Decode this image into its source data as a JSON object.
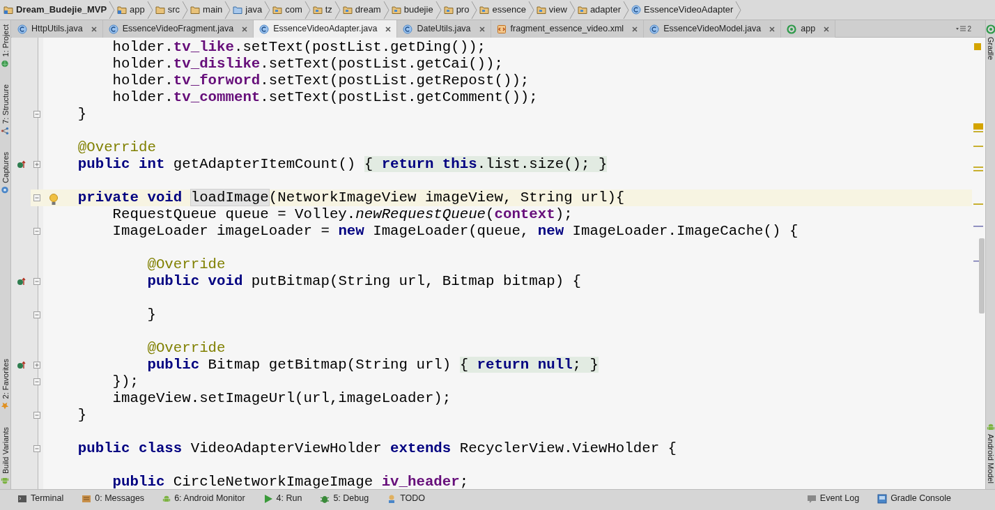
{
  "breadcrumbs": [
    {
      "label": "Dream_Budejie_MVP",
      "kind": "module"
    },
    {
      "label": "app",
      "kind": "module"
    },
    {
      "label": "src",
      "kind": "folder"
    },
    {
      "label": "main",
      "kind": "folder"
    },
    {
      "label": "java",
      "kind": "source"
    },
    {
      "label": "com",
      "kind": "package"
    },
    {
      "label": "tz",
      "kind": "package"
    },
    {
      "label": "dream",
      "kind": "package"
    },
    {
      "label": "budejie",
      "kind": "package"
    },
    {
      "label": "pro",
      "kind": "package"
    },
    {
      "label": "essence",
      "kind": "package"
    },
    {
      "label": "view",
      "kind": "package"
    },
    {
      "label": "adapter",
      "kind": "package"
    },
    {
      "label": "EssenceVideoAdapter",
      "kind": "class"
    }
  ],
  "tabs": [
    {
      "label": "HttpUtils.java",
      "kind": "class",
      "selected": false
    },
    {
      "label": "EssenceVideoFragment.java",
      "kind": "class",
      "selected": false
    },
    {
      "label": "EssenceVideoAdapter.java",
      "kind": "class",
      "selected": true
    },
    {
      "label": "DateUtils.java",
      "kind": "class",
      "selected": false
    },
    {
      "label": "fragment_essence_video.xml",
      "kind": "xml",
      "selected": false
    },
    {
      "label": "EssenceVideoModel.java",
      "kind": "class",
      "selected": false
    },
    {
      "label": "app",
      "kind": "app",
      "selected": false
    }
  ],
  "tab_overflow": "2",
  "left_tool_windows": [
    {
      "label": "1: Project",
      "kind": "project"
    },
    {
      "label": "7: Structure",
      "kind": "structure"
    },
    {
      "label": "Captures",
      "kind": "captures"
    },
    {
      "label": "2: Favorites",
      "kind": "favorites"
    },
    {
      "label": "Build Variants",
      "kind": "android"
    }
  ],
  "right_tool_windows": [
    {
      "label": "Gradle",
      "kind": "gradle"
    },
    {
      "label": "Android Model",
      "kind": "android"
    }
  ],
  "editor": {
    "lines": [
      {
        "tokens": [
          {
            "kind": "plain",
            "text": "        holder."
          },
          {
            "kind": "field",
            "text": "tv_like"
          },
          {
            "kind": "plain",
            "text": ".setText(postList.getDing());"
          }
        ],
        "current": false
      },
      {
        "tokens": [
          {
            "kind": "plain",
            "text": "        holder."
          },
          {
            "kind": "field",
            "text": "tv_dislike"
          },
          {
            "kind": "plain",
            "text": ".setText(postList.getCai());"
          }
        ],
        "current": false
      },
      {
        "tokens": [
          {
            "kind": "plain",
            "text": "        holder."
          },
          {
            "kind": "field",
            "text": "tv_forword"
          },
          {
            "kind": "plain",
            "text": ".setText(postList.getRepost());"
          }
        ],
        "current": false
      },
      {
        "tokens": [
          {
            "kind": "plain",
            "text": "        holder."
          },
          {
            "kind": "field",
            "text": "tv_comment"
          },
          {
            "kind": "plain",
            "text": ".setText(postList.getComment());"
          }
        ],
        "current": false
      },
      {
        "tokens": [
          {
            "kind": "plain",
            "text": "    }"
          }
        ],
        "gutter": [
          {
            "kind": "fold-end"
          }
        ],
        "current": false
      },
      {
        "current": false
      },
      {
        "tokens": [
          {
            "kind": "ann",
            "text": "    @Override"
          }
        ],
        "current": false
      },
      {
        "tokens": [
          {
            "kind": "kw",
            "text": "    public int"
          },
          {
            "kind": "plain",
            "text": " getAdapterItemCount() "
          },
          {
            "kind": "folded",
            "text": "{ **return** **this**.list.size(); }"
          }
        ],
        "gutter": [
          {
            "kind": "override"
          },
          {
            "kind": "fold-collapsed"
          }
        ],
        "current": false
      },
      {
        "current": false
      },
      {
        "tokens": [
          {
            "kind": "kw",
            "text": "    private void "
          },
          {
            "kind": "usage",
            "text": "loadImage"
          },
          {
            "kind": "plain",
            "text": "(NetworkImageView imageView, String url){"
          }
        ],
        "gutter": [
          {
            "kind": "fold-start"
          },
          {
            "kind": "bulb"
          }
        ],
        "current": true
      },
      {
        "tokens": [
          {
            "kind": "plain",
            "text": "        RequestQueue queue = Volley."
          },
          {
            "kind": "static",
            "text": "newRequestQueue"
          },
          {
            "kind": "plain",
            "text": "("
          },
          {
            "kind": "field",
            "text": "context"
          },
          {
            "kind": "plain",
            "text": ");"
          }
        ],
        "current": false
      },
      {
        "tokens": [
          {
            "kind": "plain",
            "text": "        ImageLoader imageLoader = "
          },
          {
            "kind": "kw",
            "text": "new"
          },
          {
            "kind": "plain",
            "text": " ImageLoader(queue, "
          },
          {
            "kind": "kw",
            "text": "new"
          },
          {
            "kind": "plain",
            "text": " ImageLoader.ImageCache() {"
          }
        ],
        "gutter": [
          {
            "kind": "fold-start"
          }
        ],
        "current": false
      },
      {
        "current": false
      },
      {
        "tokens": [
          {
            "kind": "ann",
            "text": "            @Override"
          }
        ],
        "current": false
      },
      {
        "tokens": [
          {
            "kind": "kw",
            "text": "            public void"
          },
          {
            "kind": "plain",
            "text": " putBitmap(String url, Bitmap bitmap) {"
          }
        ],
        "gutter": [
          {
            "kind": "override"
          },
          {
            "kind": "fold-start"
          }
        ],
        "current": false
      },
      {
        "current": false
      },
      {
        "tokens": [
          {
            "kind": "plain",
            "text": "            }"
          }
        ],
        "gutter": [
          {
            "kind": "fold-end"
          }
        ],
        "current": false
      },
      {
        "current": false
      },
      {
        "tokens": [
          {
            "kind": "ann",
            "text": "            @Override"
          }
        ],
        "current": false
      },
      {
        "tokens": [
          {
            "kind": "kw",
            "text": "            public"
          },
          {
            "kind": "plain",
            "text": " Bitmap getBitmap(String url) "
          },
          {
            "kind": "folded",
            "text": "{ **return** **null**; }"
          }
        ],
        "gutter": [
          {
            "kind": "override"
          },
          {
            "kind": "fold-collapsed"
          }
        ],
        "current": false
      },
      {
        "tokens": [
          {
            "kind": "plain",
            "text": "        });"
          }
        ],
        "gutter": [
          {
            "kind": "fold-end"
          }
        ],
        "current": false
      },
      {
        "tokens": [
          {
            "kind": "plain",
            "text": "        imageView.setImageUrl(url,imageLoader);"
          }
        ],
        "current": false
      },
      {
        "tokens": [
          {
            "kind": "plain",
            "text": "    }"
          }
        ],
        "gutter": [
          {
            "kind": "fold-end"
          }
        ],
        "current": false
      },
      {
        "current": false
      },
      {
        "tokens": [
          {
            "kind": "kw",
            "text": "    public class"
          },
          {
            "kind": "plain",
            "text": " VideoAdapterViewHolder "
          },
          {
            "kind": "kw",
            "text": "extends"
          },
          {
            "kind": "plain",
            "text": " RecyclerView.ViewHolder {"
          }
        ],
        "gutter": [
          {
            "kind": "fold-start"
          }
        ],
        "current": false
      },
      {
        "current": false
      },
      {
        "tokens": [
          {
            "kind": "kw",
            "text": "        public"
          },
          {
            "kind": "plain",
            "text": " CircleNetworkImageImage "
          },
          {
            "kind": "field",
            "text": "iv_header"
          },
          {
            "kind": "plain",
            "text": ";"
          }
        ],
        "current": false
      }
    ]
  },
  "bottom_tool_windows": {
    "left": [
      {
        "label": "Terminal",
        "kind": "terminal"
      },
      {
        "label": "0: Messages",
        "kind": "messages"
      },
      {
        "label": "6: Android Monitor",
        "kind": "android"
      },
      {
        "label": "4: Run",
        "kind": "run"
      },
      {
        "label": "5: Debug",
        "kind": "debug"
      },
      {
        "label": "TODO",
        "kind": "todo"
      }
    ],
    "right": [
      {
        "label": "Event Log",
        "kind": "eventlog"
      },
      {
        "label": "Gradle Console",
        "kind": "gradleconsole"
      }
    ]
  }
}
